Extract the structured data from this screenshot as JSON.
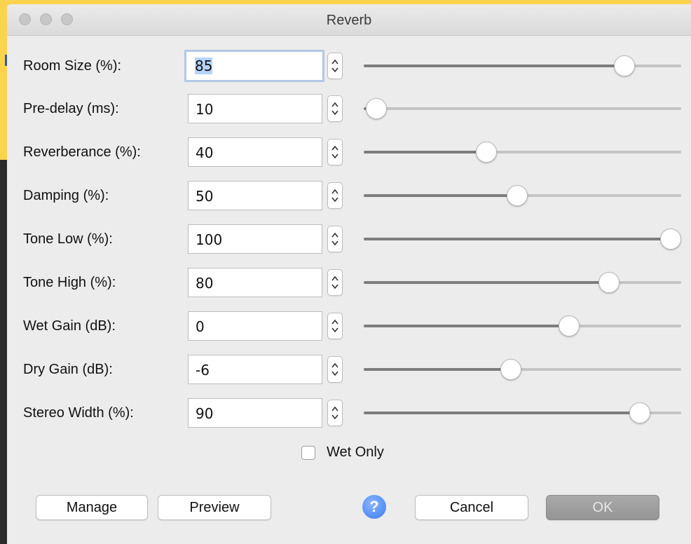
{
  "window": {
    "title": "Reverb"
  },
  "params": [
    {
      "label": "Room Size (%):",
      "value": "85",
      "level": 0.85,
      "focused": true
    },
    {
      "label": "Pre-delay (ms):",
      "value": "10",
      "level": 0.04,
      "focused": false
    },
    {
      "label": "Reverberance (%):",
      "value": "40",
      "level": 0.4,
      "focused": false
    },
    {
      "label": "Damping (%):",
      "value": "50",
      "level": 0.5,
      "focused": false
    },
    {
      "label": "Tone Low (%):",
      "value": "100",
      "level": 1.0,
      "focused": false
    },
    {
      "label": "Tone High (%):",
      "value": "80",
      "level": 0.8,
      "focused": false
    },
    {
      "label": "Wet Gain (dB):",
      "value": "0",
      "level": 0.67,
      "focused": false
    },
    {
      "label": "Dry Gain (dB):",
      "value": "-6",
      "level": 0.48,
      "focused": false
    },
    {
      "label": "Stereo Width (%):",
      "value": "90",
      "level": 0.9,
      "focused": false
    }
  ],
  "wet_only": {
    "label": "Wet Only",
    "checked": false
  },
  "buttons": {
    "manage": "Manage",
    "preview": "Preview",
    "help": "?",
    "cancel": "Cancel",
    "ok": "OK"
  },
  "colors": {
    "background": "#fcd34d",
    "window": "#ececec",
    "help": "#3b7cf0"
  }
}
